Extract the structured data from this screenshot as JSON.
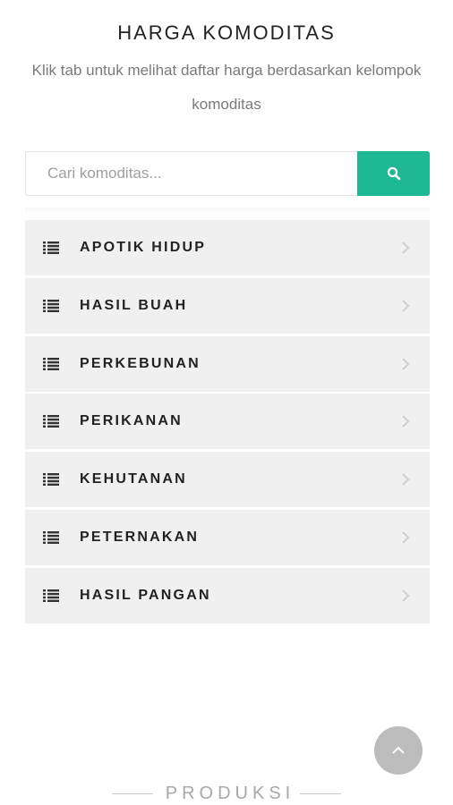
{
  "header": {
    "title": "HARGA KOMODITAS",
    "subtitle": "Klik tab untuk melihat daftar harga berdasarkan kelompok komoditas"
  },
  "search": {
    "placeholder": "Cari komoditas...",
    "value": "",
    "button_icon": "search-icon",
    "accent_color": "#1fb894"
  },
  "categories": [
    {
      "label": "APOTIK HIDUP",
      "icon": "list-icon"
    },
    {
      "label": "HASIL BUAH",
      "icon": "list-icon"
    },
    {
      "label": "PERKEBUNAN",
      "icon": "list-icon"
    },
    {
      "label": "PERIKANAN",
      "icon": "list-icon"
    },
    {
      "label": "KEHUTANAN",
      "icon": "list-icon"
    },
    {
      "label": "PETERNAKAN",
      "icon": "list-icon"
    },
    {
      "label": "HASIL PANGAN",
      "icon": "list-icon"
    }
  ],
  "scroll_top_button": {
    "icon": "chevron-up-icon"
  },
  "footer": {
    "section_heading": "PRODUKSI"
  }
}
